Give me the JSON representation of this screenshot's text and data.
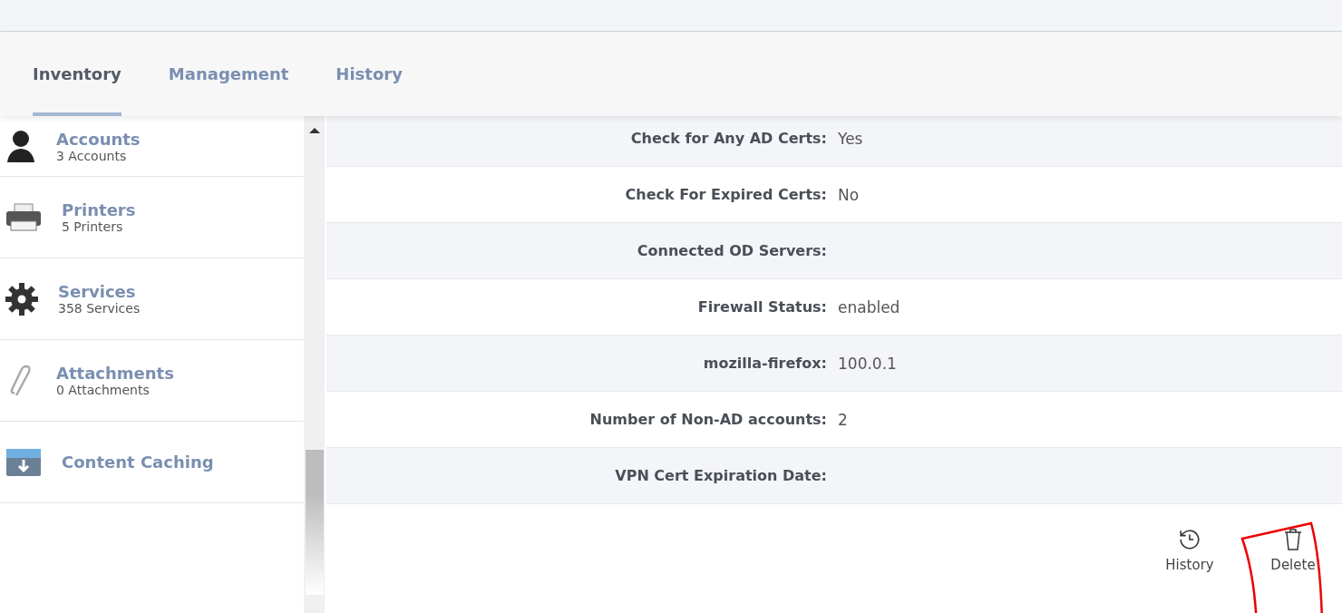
{
  "tabs": [
    {
      "label": "Inventory",
      "selected": true
    },
    {
      "label": "Management",
      "selected": false
    },
    {
      "label": "History",
      "selected": false
    }
  ],
  "sidebar": {
    "items": [
      {
        "kind": "user",
        "title": "Accounts",
        "subtitle": "3 Accounts"
      },
      {
        "kind": "printer",
        "title": "Printers",
        "subtitle": "5 Printers"
      },
      {
        "kind": "gear",
        "title": "Services",
        "subtitle": "358 Services"
      },
      {
        "kind": "paperclip",
        "title": "Attachments",
        "subtitle": "0 Attachments"
      },
      {
        "kind": "box",
        "title": "Content Caching"
      }
    ]
  },
  "attributes": [
    {
      "label": "Check for Any AD Certs:",
      "value": "Yes"
    },
    {
      "label": "Check For Expired Certs:",
      "value": "No"
    },
    {
      "label": "Connected OD Servers:"
    },
    {
      "label": "Firewall Status:",
      "value": "enabled"
    },
    {
      "label": "mozilla-firefox:",
      "value": "100.0.1"
    },
    {
      "label": "Number of Non-AD accounts:",
      "value": "2"
    },
    {
      "label": "VPN Cert Expiration Date:"
    }
  ],
  "actions": [
    {
      "kind": "history",
      "label": "History"
    },
    {
      "kind": "delete",
      "label": "Delete",
      "annotated": true
    }
  ]
}
